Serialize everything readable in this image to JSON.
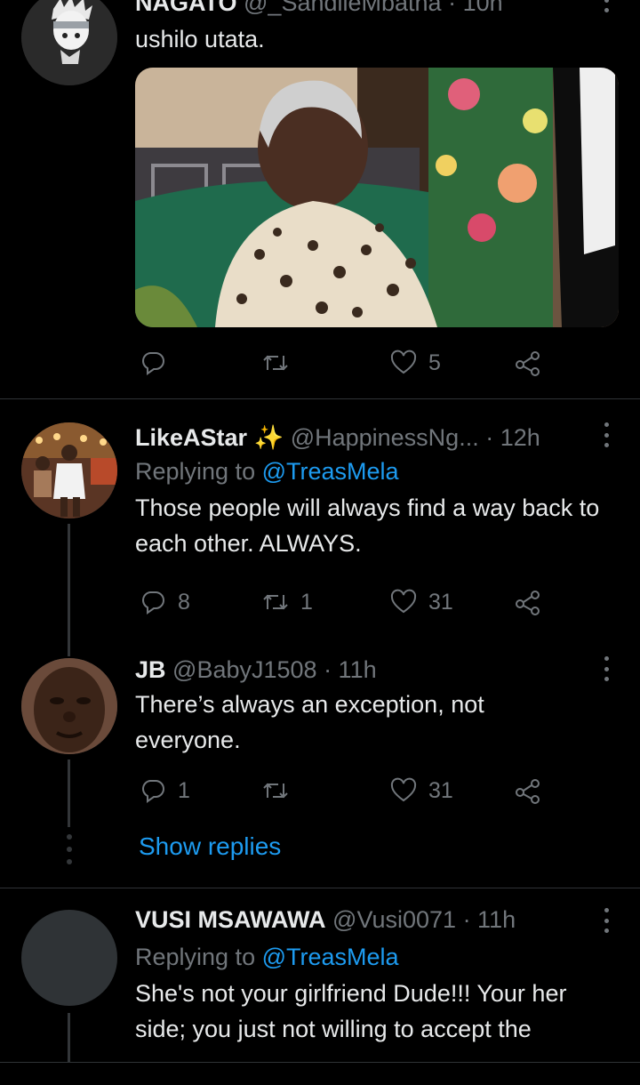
{
  "tweets": [
    {
      "name": "NAGATO",
      "handle": "@_SandileMbatha",
      "time": "· 10h",
      "text": "ushilo utata.",
      "actions": {
        "replies": "",
        "retweets": "",
        "likes": "5"
      }
    },
    {
      "name": "LikeAStar ✨",
      "handle": "@HappinessNg...",
      "time": "· 12h",
      "replying_label": "Replying to",
      "replying_to": "@TreasMela",
      "text": "Those people will always find a way back to each other. ALWAYS.",
      "actions": {
        "replies": "8",
        "retweets": "1",
        "likes": "31"
      }
    },
    {
      "name": "JB",
      "handle": "@BabyJ1508",
      "time": "· 11h",
      "text": "There’s always an exception, not everyone.",
      "actions": {
        "replies": "1",
        "retweets": "",
        "likes": "31"
      },
      "show_replies": "Show replies"
    },
    {
      "name": "VUSI MSAWAWA",
      "handle": "@Vusi0071",
      "time": "· 11h",
      "replying_label": "Replying to",
      "replying_to": "@TreasMela",
      "text": "She's not your girlfriend Dude!!! Your her side; you just not willing to accept the"
    }
  ],
  "colors": {
    "background": "#000000",
    "text": "#e7e9ea",
    "muted": "#71767b",
    "link": "#1d9bf0",
    "divider": "#2f3336"
  },
  "icons": [
    "reply-icon",
    "retweet-icon",
    "like-icon",
    "share-icon",
    "more-icon"
  ]
}
